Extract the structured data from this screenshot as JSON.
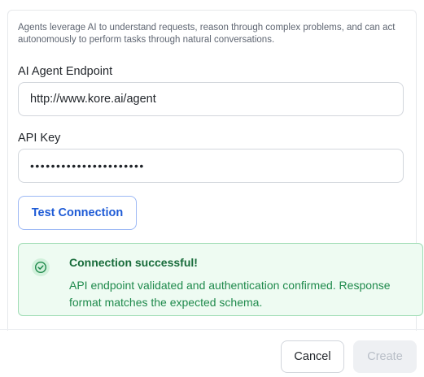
{
  "dialog": {
    "description": "Agents leverage AI to understand requests, reason through complex problems, and can act autonomously to perform tasks through natural conversations.",
    "endpoint": {
      "label": "AI Agent Endpoint",
      "value": "http://www.kore.ai/agent"
    },
    "api_key": {
      "label": "API Key",
      "value": "••••••••••••••••••••••"
    },
    "test_button": "Test Connection",
    "status": {
      "icon": "check-circle-icon",
      "title": "Connection successful!",
      "message": "API endpoint validated and authentication confirmed. Response format matches the expected schema.",
      "color": "#1f8a4c"
    }
  },
  "footer": {
    "cancel_label": "Cancel",
    "create_label": "Create"
  },
  "colors": {
    "accent": "#1e5bd6",
    "success_bg": "#eefbf2",
    "success_border": "#9fdcb4"
  }
}
